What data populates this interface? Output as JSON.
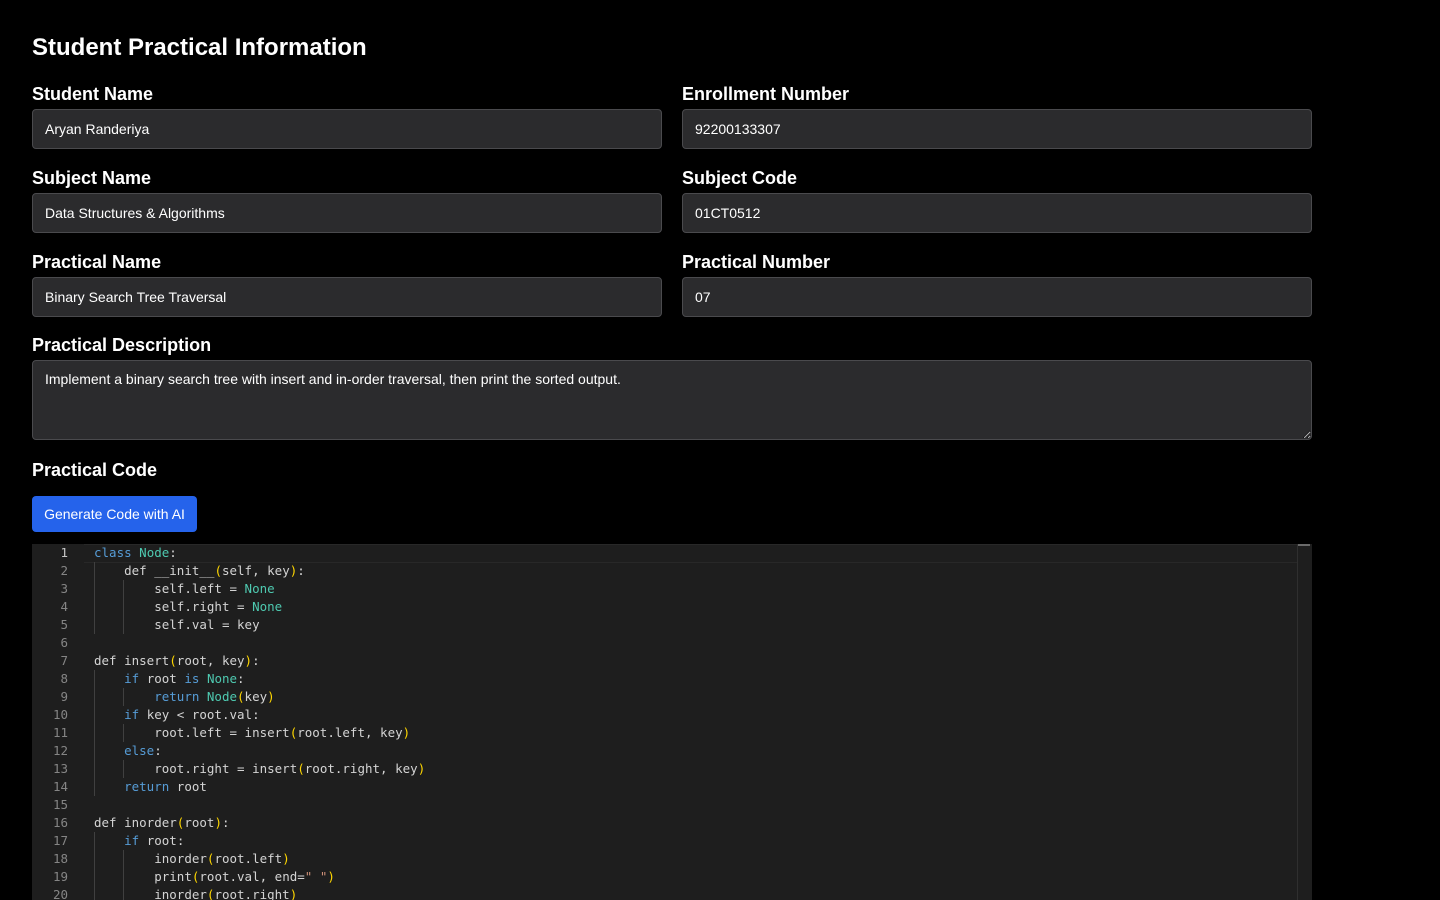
{
  "page": {
    "title": "Student Practical Information"
  },
  "fields": {
    "student_name": {
      "label": "Student Name",
      "value": "Aryan Randeriya"
    },
    "enrollment_number": {
      "label": "Enrollment Number",
      "value": "92200133307"
    },
    "subject_name": {
      "label": "Subject Name",
      "value": "Data Structures & Algorithms"
    },
    "subject_code": {
      "label": "Subject Code",
      "value": "01CT0512"
    },
    "practical_name": {
      "label": "Practical Name",
      "value": "Binary Search Tree Traversal"
    },
    "practical_number": {
      "label": "Practical Number",
      "value": "07"
    },
    "practical_description": {
      "label": "Practical Description",
      "value": "Implement a binary search tree with insert and in-order traversal, then print the sorted output."
    }
  },
  "code_section": {
    "label": "Practical Code",
    "generate_button": "Generate Code with AI"
  },
  "editor": {
    "lines": [
      "class Node:",
      "    def __init__(self, key):",
      "        self.left = None",
      "        self.right = None",
      "        self.val = key",
      "",
      "def insert(root, key):",
      "    if root is None:",
      "        return Node(key)",
      "    if key < root.val:",
      "        root.left = insert(root.left, key)",
      "    else:",
      "        root.right = insert(root.right, key)",
      "    return root",
      "",
      "def inorder(root):",
      "    if root:",
      "        inorder(root.left)",
      "        print(root.val, end=\" \")",
      "        inorder(root.right)"
    ],
    "line_numbers": [
      "1",
      "2",
      "3",
      "4",
      "5",
      "6",
      "7",
      "8",
      "9",
      "10",
      "11",
      "12",
      "13",
      "14",
      "15",
      "16",
      "17",
      "18",
      "19",
      "20"
    ],
    "colors": {
      "keyword": "#569cd6",
      "class_name": "#4ec9b0",
      "bracket": "#ffd700",
      "string": "#ce9178",
      "text": "#d4d4d4",
      "background": "#1e1e1e"
    }
  },
  "colors": {
    "page_background": "#000000",
    "input_background": "#2b2b2d",
    "button_accent": "#2563eb"
  }
}
